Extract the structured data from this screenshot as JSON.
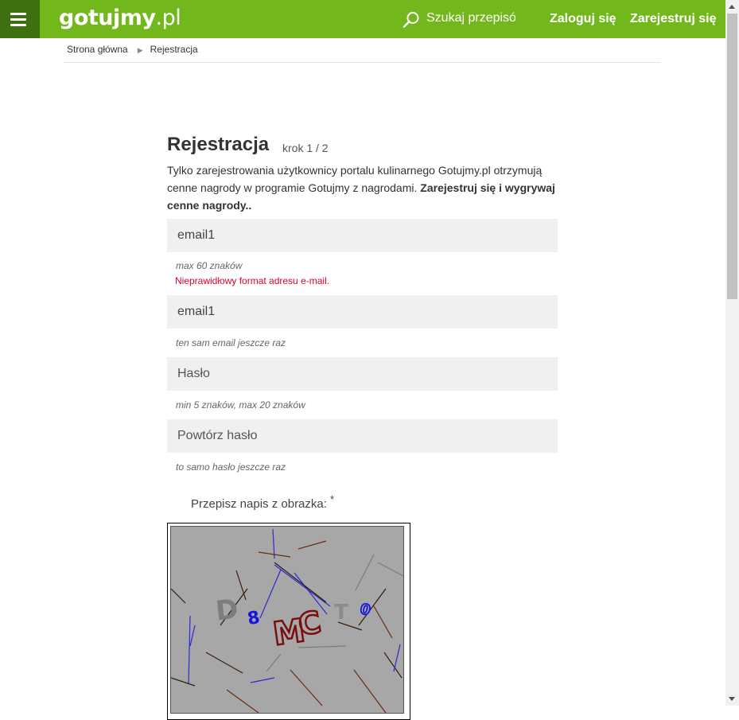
{
  "header": {
    "logo_main": "gotujmy",
    "logo_tld": ".pl",
    "search_placeholder": "Szukaj przepisów",
    "login_label": "Zaloguj się",
    "register_label": "Zarejestruj się",
    "colors": {
      "bar": "#72b71c",
      "menu": "#3f7010"
    },
    "icons": [
      "hamburger-icon",
      "search-icon"
    ]
  },
  "breadcrumb": {
    "items": [
      "Strona główna",
      "Rejestracja"
    ]
  },
  "form": {
    "title": "Rejestracja",
    "step": "krok 1 / 2",
    "intro_text": "Tylko zarejestrowania użytkownicy portalu kulinarnego Gotujmy.pl otrzymują cenne nagrody w programie Gotujmy z nagrodami. ",
    "intro_bold": "Zarejestruj się i wygrywaj cenne nagrody..",
    "email": {
      "value": "email1",
      "hint": "max 60 znaków",
      "error": "Nieprawidłowy format adresu e-mail."
    },
    "email_confirm": {
      "value": "email1",
      "hint": "ten sam email jeszcze raz"
    },
    "password": {
      "placeholder": "Hasło",
      "hint": "min 5 znaków, max 20 znaków"
    },
    "password_confirm": {
      "placeholder": "Powtórz hasło",
      "hint": "to samo hasło jeszcze raz"
    },
    "captcha": {
      "label": "Przepisz napis z obrazka:",
      "required_mark": "*",
      "glyphs": [
        "D",
        "8",
        "M",
        "C",
        "T",
        "0"
      ]
    }
  }
}
